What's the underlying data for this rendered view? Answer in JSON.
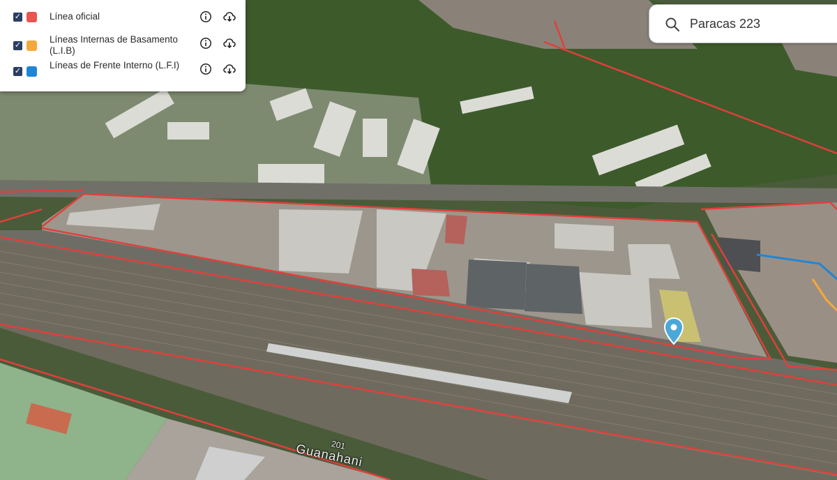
{
  "legend": {
    "layers": [
      {
        "label": "Línea oficial",
        "color": "#e8554e",
        "checked": true
      },
      {
        "label": "Líneas Internas de Basamento (L.I.B)",
        "color": "#f4a93b",
        "checked": true
      },
      {
        "label": "Líneas de Frente Interno (L.F.I)",
        "color": "#1f86d6",
        "checked": true
      }
    ],
    "icons": {
      "info": "info-icon",
      "download": "cloud-download-icon",
      "checkbox": "checkbox-checked-icon"
    }
  },
  "search": {
    "value": "Paracas 223",
    "icon": "search-icon"
  },
  "map": {
    "road_number": "201",
    "road_name": "Guanahani",
    "marker": "location-pin-icon",
    "colors": {
      "official_line": "#e0403a",
      "lib_line": "#f4a93b",
      "lfi_line": "#1f86d6",
      "marker": "#4aa8d8"
    }
  }
}
